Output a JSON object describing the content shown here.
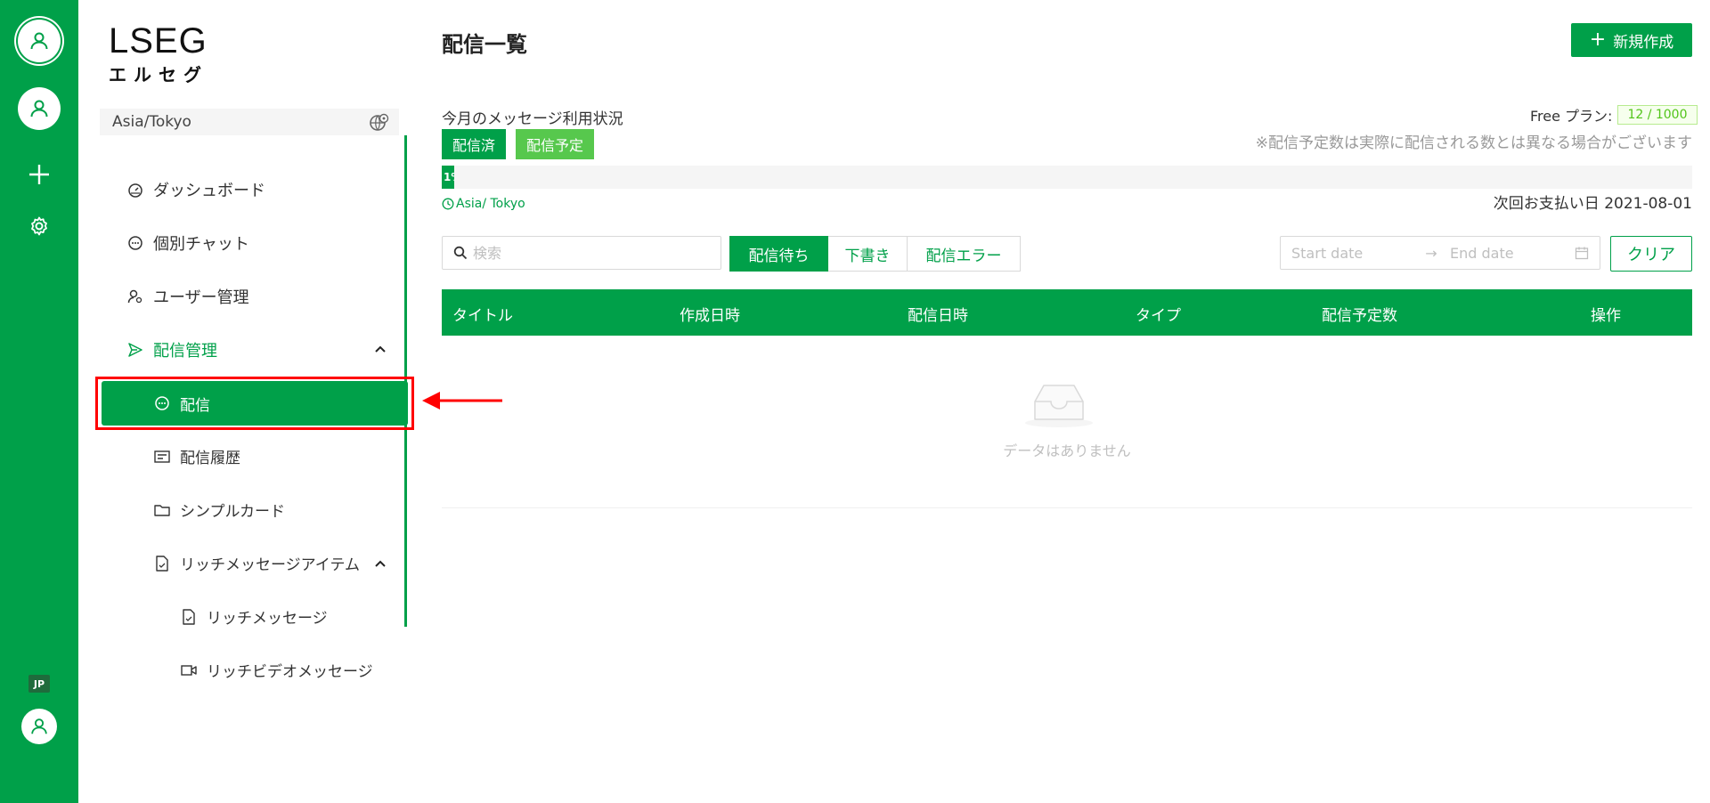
{
  "rail": {
    "lang": "JP"
  },
  "sidebar": {
    "logo_main": "LSEG",
    "logo_sub": "エルセグ",
    "timezone": "Asia/Tokyo",
    "items": {
      "dashboard": "ダッシュボード",
      "chat": "個別チャット",
      "users": "ユーザー管理",
      "delivery_mgmt": "配信管理",
      "delivery": "配信",
      "history": "配信履歴",
      "simple_card": "シンプルカード",
      "rich_items": "リッチメッセージアイテム",
      "rich_message": "リッチメッセージ",
      "rich_video": "リッチビデオメッセージ"
    }
  },
  "header": {
    "title": "配信一覧",
    "new_button": "新規作成"
  },
  "usage": {
    "label": "今月のメッセージ利用状況",
    "tag_sent": "配信済",
    "tag_scheduled": "配信予定",
    "plan_label": "Free プラン:",
    "plan_count": "12 / 1000",
    "notice": "※配信予定数は実際に配信される数とは異なる場合がございます",
    "progress_text": "1%",
    "progress_percent": 1,
    "timezone": "Asia/ Tokyo",
    "next_payment": "次回お支払い日 2021-08-01"
  },
  "filters": {
    "search_placeholder": "検索",
    "tabs": [
      "配信待ち",
      "下書き",
      "配信エラー"
    ],
    "active_tab": 0,
    "start_placeholder": "Start date",
    "end_placeholder": "End date",
    "clear_button": "クリア"
  },
  "table": {
    "columns": [
      "タイトル",
      "作成日時",
      "配信日時",
      "タイプ",
      "配信予定数",
      "操作"
    ],
    "empty_text": "データはありません"
  },
  "colors": {
    "brand": "#00a049",
    "light_green": "#57c84d",
    "highlight": "#ff0000"
  }
}
